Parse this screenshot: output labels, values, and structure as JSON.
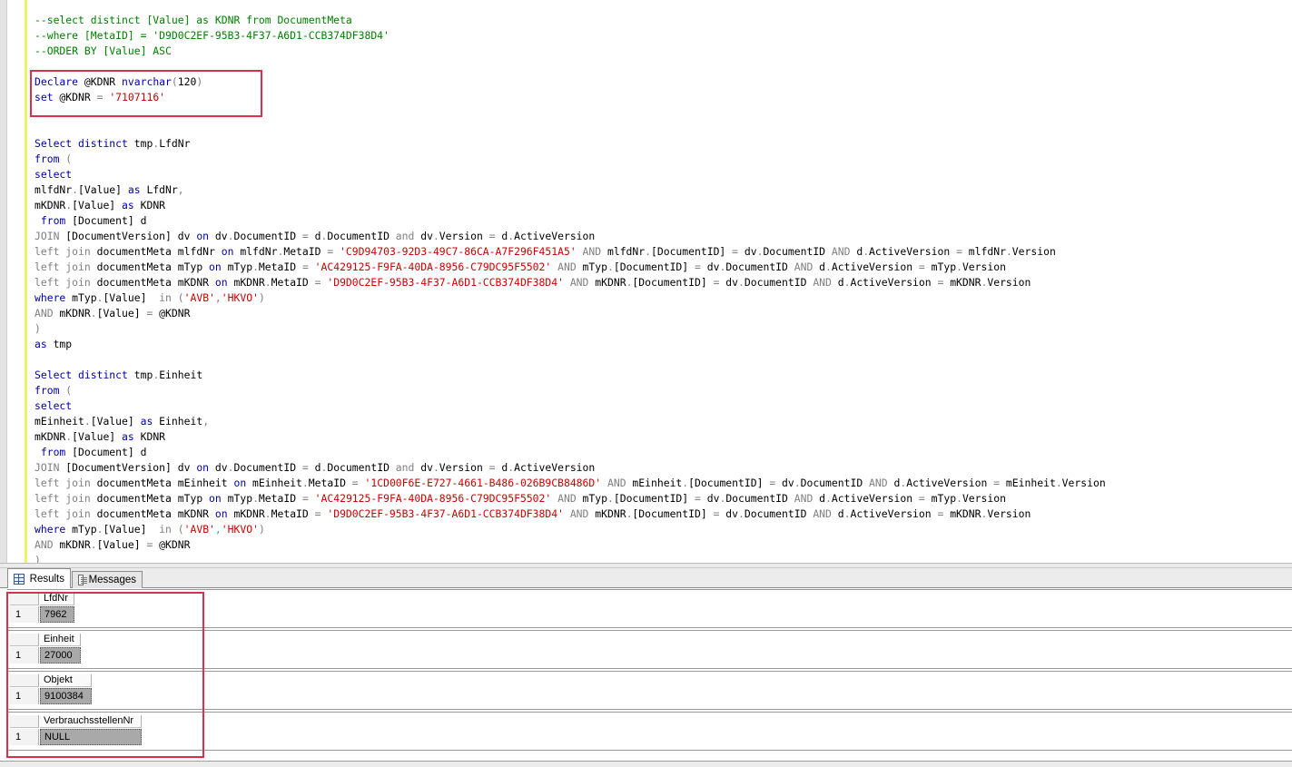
{
  "editor": {
    "lines": [
      [
        {
          "t": "--select distinct [Value] as KDNR from DocumentMeta",
          "c": "cmt"
        }
      ],
      [
        {
          "t": "--where [MetaID] = 'D9D0C2EF-95B3-4F37-A6D1-CCB374DF38D4'",
          "c": "cmt"
        }
      ],
      [
        {
          "t": "--ORDER BY [Value] ASC",
          "c": "cmt"
        }
      ],
      [],
      [
        {
          "t": "Declare",
          "c": "kw2"
        },
        {
          "t": " @KDNR "
        },
        {
          "t": "nvarchar",
          "c": "kw2"
        },
        {
          "t": "(",
          "c": "gray"
        },
        {
          "t": "120"
        },
        {
          "t": ")",
          "c": "gray"
        }
      ],
      [
        {
          "t": "set",
          "c": "kw2"
        },
        {
          "t": " @KDNR "
        },
        {
          "t": "=",
          "c": "gray"
        },
        {
          "t": " "
        },
        {
          "t": "'7107116'",
          "c": "str"
        }
      ],
      [],
      [],
      [
        {
          "t": "Select",
          "c": "kw2"
        },
        {
          "t": " "
        },
        {
          "t": "distinct",
          "c": "kw2"
        },
        {
          "t": " tmp"
        },
        {
          "t": ".",
          "c": "gray"
        },
        {
          "t": "LfdNr"
        }
      ],
      [
        {
          "t": "from",
          "c": "kw2"
        },
        {
          "t": " "
        },
        {
          "t": "(",
          "c": "gray"
        }
      ],
      [
        {
          "t": "select",
          "c": "kw2"
        }
      ],
      [
        {
          "t": "mlfdNr"
        },
        {
          "t": ".",
          "c": "gray"
        },
        {
          "t": "[Value] "
        },
        {
          "t": "as",
          "c": "kw2"
        },
        {
          "t": " LfdNr"
        },
        {
          "t": ",",
          "c": "gray"
        }
      ],
      [
        {
          "t": "mKDNR"
        },
        {
          "t": ".",
          "c": "gray"
        },
        {
          "t": "[Value] "
        },
        {
          "t": "as",
          "c": "kw2"
        },
        {
          "t": " KDNR"
        }
      ],
      [
        {
          "t": " "
        },
        {
          "t": "from",
          "c": "kw2"
        },
        {
          "t": " [Document] d"
        }
      ],
      [
        {
          "t": "JOIN",
          "c": "gray"
        },
        {
          "t": " [DocumentVersion] dv "
        },
        {
          "t": "on",
          "c": "kw2"
        },
        {
          "t": " dv"
        },
        {
          "t": ".",
          "c": "gray"
        },
        {
          "t": "DocumentID "
        },
        {
          "t": "=",
          "c": "gray"
        },
        {
          "t": " d"
        },
        {
          "t": ".",
          "c": "gray"
        },
        {
          "t": "DocumentID "
        },
        {
          "t": "and",
          "c": "gray"
        },
        {
          "t": " dv"
        },
        {
          "t": ".",
          "c": "gray"
        },
        {
          "t": "Version "
        },
        {
          "t": "=",
          "c": "gray"
        },
        {
          "t": " d"
        },
        {
          "t": ".",
          "c": "gray"
        },
        {
          "t": "ActiveVersion"
        }
      ],
      [
        {
          "t": "left join",
          "c": "gray"
        },
        {
          "t": " documentMeta mlfdNr "
        },
        {
          "t": "on",
          "c": "kw2"
        },
        {
          "t": " mlfdNr"
        },
        {
          "t": ".",
          "c": "gray"
        },
        {
          "t": "MetaID "
        },
        {
          "t": "=",
          "c": "gray"
        },
        {
          "t": " "
        },
        {
          "t": "'C9D94703-92D3-49C7-86CA-A7F296F451A5'",
          "c": "str"
        },
        {
          "t": " "
        },
        {
          "t": "AND",
          "c": "gray"
        },
        {
          "t": " mlfdNr"
        },
        {
          "t": ".",
          "c": "gray"
        },
        {
          "t": "[DocumentID] "
        },
        {
          "t": "=",
          "c": "gray"
        },
        {
          "t": " dv"
        },
        {
          "t": ".",
          "c": "gray"
        },
        {
          "t": "DocumentID "
        },
        {
          "t": "AND",
          "c": "gray"
        },
        {
          "t": " d"
        },
        {
          "t": ".",
          "c": "gray"
        },
        {
          "t": "ActiveVersion "
        },
        {
          "t": "=",
          "c": "gray"
        },
        {
          "t": " mlfdNr"
        },
        {
          "t": ".",
          "c": "gray"
        },
        {
          "t": "Version"
        }
      ],
      [
        {
          "t": "left join",
          "c": "gray"
        },
        {
          "t": " documentMeta mTyp "
        },
        {
          "t": "on",
          "c": "kw2"
        },
        {
          "t": " mTyp"
        },
        {
          "t": ".",
          "c": "gray"
        },
        {
          "t": "MetaID "
        },
        {
          "t": "=",
          "c": "gray"
        },
        {
          "t": " "
        },
        {
          "t": "'AC429125-F9FA-40DA-8956-C79DC95F5502'",
          "c": "str"
        },
        {
          "t": " "
        },
        {
          "t": "AND",
          "c": "gray"
        },
        {
          "t": " mTyp"
        },
        {
          "t": ".",
          "c": "gray"
        },
        {
          "t": "[DocumentID] "
        },
        {
          "t": "=",
          "c": "gray"
        },
        {
          "t": " dv"
        },
        {
          "t": ".",
          "c": "gray"
        },
        {
          "t": "DocumentID "
        },
        {
          "t": "AND",
          "c": "gray"
        },
        {
          "t": " d"
        },
        {
          "t": ".",
          "c": "gray"
        },
        {
          "t": "ActiveVersion "
        },
        {
          "t": "=",
          "c": "gray"
        },
        {
          "t": " mTyp"
        },
        {
          "t": ".",
          "c": "gray"
        },
        {
          "t": "Version"
        }
      ],
      [
        {
          "t": "left join",
          "c": "gray"
        },
        {
          "t": " documentMeta mKDNR "
        },
        {
          "t": "on",
          "c": "kw2"
        },
        {
          "t": " mKDNR"
        },
        {
          "t": ".",
          "c": "gray"
        },
        {
          "t": "MetaID "
        },
        {
          "t": "=",
          "c": "gray"
        },
        {
          "t": " "
        },
        {
          "t": "'D9D0C2EF-95B3-4F37-A6D1-CCB374DF38D4'",
          "c": "str"
        },
        {
          "t": " "
        },
        {
          "t": "AND",
          "c": "gray"
        },
        {
          "t": " mKDNR"
        },
        {
          "t": ".",
          "c": "gray"
        },
        {
          "t": "[DocumentID] "
        },
        {
          "t": "=",
          "c": "gray"
        },
        {
          "t": " dv"
        },
        {
          "t": ".",
          "c": "gray"
        },
        {
          "t": "DocumentID "
        },
        {
          "t": "AND",
          "c": "gray"
        },
        {
          "t": " d"
        },
        {
          "t": ".",
          "c": "gray"
        },
        {
          "t": "ActiveVersion "
        },
        {
          "t": "=",
          "c": "gray"
        },
        {
          "t": " mKDNR"
        },
        {
          "t": ".",
          "c": "gray"
        },
        {
          "t": "Version"
        }
      ],
      [
        {
          "t": "where",
          "c": "kw2"
        },
        {
          "t": " mTyp"
        },
        {
          "t": ".",
          "c": "gray"
        },
        {
          "t": "[Value]  "
        },
        {
          "t": "in",
          "c": "gray"
        },
        {
          "t": " "
        },
        {
          "t": "(",
          "c": "gray"
        },
        {
          "t": "'AVB'",
          "c": "str"
        },
        {
          "t": ",",
          "c": "gray"
        },
        {
          "t": "'HKVO'",
          "c": "str"
        },
        {
          "t": ")",
          "c": "gray"
        }
      ],
      [
        {
          "t": "AND",
          "c": "gray"
        },
        {
          "t": " mKDNR"
        },
        {
          "t": ".",
          "c": "gray"
        },
        {
          "t": "[Value] "
        },
        {
          "t": "=",
          "c": "gray"
        },
        {
          "t": " @KDNR"
        }
      ],
      [
        {
          "t": ")",
          "c": "gray"
        }
      ],
      [
        {
          "t": "as",
          "c": "kw2"
        },
        {
          "t": " tmp"
        }
      ],
      [],
      [
        {
          "t": "Select",
          "c": "kw2"
        },
        {
          "t": " "
        },
        {
          "t": "distinct",
          "c": "kw2"
        },
        {
          "t": " tmp"
        },
        {
          "t": ".",
          "c": "gray"
        },
        {
          "t": "Einheit"
        }
      ],
      [
        {
          "t": "from",
          "c": "kw2"
        },
        {
          "t": " "
        },
        {
          "t": "(",
          "c": "gray"
        }
      ],
      [
        {
          "t": "select",
          "c": "kw2"
        }
      ],
      [
        {
          "t": "mEinheit"
        },
        {
          "t": ".",
          "c": "gray"
        },
        {
          "t": "[Value] "
        },
        {
          "t": "as",
          "c": "kw2"
        },
        {
          "t": " Einheit"
        },
        {
          "t": ",",
          "c": "gray"
        }
      ],
      [
        {
          "t": "mKDNR"
        },
        {
          "t": ".",
          "c": "gray"
        },
        {
          "t": "[Value] "
        },
        {
          "t": "as",
          "c": "kw2"
        },
        {
          "t": " KDNR"
        }
      ],
      [
        {
          "t": " "
        },
        {
          "t": "from",
          "c": "kw2"
        },
        {
          "t": " [Document] d"
        }
      ],
      [
        {
          "t": "JOIN",
          "c": "gray"
        },
        {
          "t": " [DocumentVersion] dv "
        },
        {
          "t": "on",
          "c": "kw2"
        },
        {
          "t": " dv"
        },
        {
          "t": ".",
          "c": "gray"
        },
        {
          "t": "DocumentID "
        },
        {
          "t": "=",
          "c": "gray"
        },
        {
          "t": " d"
        },
        {
          "t": ".",
          "c": "gray"
        },
        {
          "t": "DocumentID "
        },
        {
          "t": "and",
          "c": "gray"
        },
        {
          "t": " dv"
        },
        {
          "t": ".",
          "c": "gray"
        },
        {
          "t": "Version "
        },
        {
          "t": "=",
          "c": "gray"
        },
        {
          "t": " d"
        },
        {
          "t": ".",
          "c": "gray"
        },
        {
          "t": "ActiveVersion"
        }
      ],
      [
        {
          "t": "left join",
          "c": "gray"
        },
        {
          "t": " documentMeta mEinheit "
        },
        {
          "t": "on",
          "c": "kw2"
        },
        {
          "t": " mEinheit"
        },
        {
          "t": ".",
          "c": "gray"
        },
        {
          "t": "MetaID "
        },
        {
          "t": "=",
          "c": "gray"
        },
        {
          "t": " "
        },
        {
          "t": "'1CD00F6E-E727-4661-B486-026B9CB8486D'",
          "c": "str"
        },
        {
          "t": " "
        },
        {
          "t": "AND",
          "c": "gray"
        },
        {
          "t": " mEinheit"
        },
        {
          "t": ".",
          "c": "gray"
        },
        {
          "t": "[DocumentID] "
        },
        {
          "t": "=",
          "c": "gray"
        },
        {
          "t": " dv"
        },
        {
          "t": ".",
          "c": "gray"
        },
        {
          "t": "DocumentID "
        },
        {
          "t": "AND",
          "c": "gray"
        },
        {
          "t": " d"
        },
        {
          "t": ".",
          "c": "gray"
        },
        {
          "t": "ActiveVersion "
        },
        {
          "t": "=",
          "c": "gray"
        },
        {
          "t": " mEinheit"
        },
        {
          "t": ".",
          "c": "gray"
        },
        {
          "t": "Version"
        }
      ],
      [
        {
          "t": "left join",
          "c": "gray"
        },
        {
          "t": " documentMeta mTyp "
        },
        {
          "t": "on",
          "c": "kw2"
        },
        {
          "t": " mTyp"
        },
        {
          "t": ".",
          "c": "gray"
        },
        {
          "t": "MetaID "
        },
        {
          "t": "=",
          "c": "gray"
        },
        {
          "t": " "
        },
        {
          "t": "'AC429125-F9FA-40DA-8956-C79DC95F5502'",
          "c": "str"
        },
        {
          "t": " "
        },
        {
          "t": "AND",
          "c": "gray"
        },
        {
          "t": " mTyp"
        },
        {
          "t": ".",
          "c": "gray"
        },
        {
          "t": "[DocumentID] "
        },
        {
          "t": "=",
          "c": "gray"
        },
        {
          "t": " dv"
        },
        {
          "t": ".",
          "c": "gray"
        },
        {
          "t": "DocumentID "
        },
        {
          "t": "AND",
          "c": "gray"
        },
        {
          "t": " d"
        },
        {
          "t": ".",
          "c": "gray"
        },
        {
          "t": "ActiveVersion "
        },
        {
          "t": "=",
          "c": "gray"
        },
        {
          "t": " mTyp"
        },
        {
          "t": ".",
          "c": "gray"
        },
        {
          "t": "Version"
        }
      ],
      [
        {
          "t": "left join",
          "c": "gray"
        },
        {
          "t": " documentMeta mKDNR "
        },
        {
          "t": "on",
          "c": "kw2"
        },
        {
          "t": " mKDNR"
        },
        {
          "t": ".",
          "c": "gray"
        },
        {
          "t": "MetaID "
        },
        {
          "t": "=",
          "c": "gray"
        },
        {
          "t": " "
        },
        {
          "t": "'D9D0C2EF-95B3-4F37-A6D1-CCB374DF38D4'",
          "c": "str"
        },
        {
          "t": " "
        },
        {
          "t": "AND",
          "c": "gray"
        },
        {
          "t": " mKDNR"
        },
        {
          "t": ".",
          "c": "gray"
        },
        {
          "t": "[DocumentID] "
        },
        {
          "t": "=",
          "c": "gray"
        },
        {
          "t": " dv"
        },
        {
          "t": ".",
          "c": "gray"
        },
        {
          "t": "DocumentID "
        },
        {
          "t": "AND",
          "c": "gray"
        },
        {
          "t": " d"
        },
        {
          "t": ".",
          "c": "gray"
        },
        {
          "t": "ActiveVersion "
        },
        {
          "t": "=",
          "c": "gray"
        },
        {
          "t": " mKDNR"
        },
        {
          "t": ".",
          "c": "gray"
        },
        {
          "t": "Version"
        }
      ],
      [
        {
          "t": "where",
          "c": "kw2"
        },
        {
          "t": " mTyp"
        },
        {
          "t": ".",
          "c": "gray"
        },
        {
          "t": "[Value]  "
        },
        {
          "t": "in",
          "c": "gray"
        },
        {
          "t": " "
        },
        {
          "t": "(",
          "c": "gray"
        },
        {
          "t": "'AVB'",
          "c": "str"
        },
        {
          "t": ",",
          "c": "gray"
        },
        {
          "t": "'HKVO'",
          "c": "str"
        },
        {
          "t": ")",
          "c": "gray"
        }
      ],
      [
        {
          "t": "AND",
          "c": "gray"
        },
        {
          "t": " mKDNR"
        },
        {
          "t": ".",
          "c": "gray"
        },
        {
          "t": "[Value] "
        },
        {
          "t": "=",
          "c": "gray"
        },
        {
          "t": " @KDNR"
        }
      ],
      [
        {
          "t": ")",
          "c": "gray"
        }
      ]
    ]
  },
  "tabs": {
    "results_label": "Results",
    "messages_label": "Messages"
  },
  "results": {
    "grids": [
      {
        "column": "LfdNr",
        "row_number": "1",
        "value": "7962"
      },
      {
        "column": "Einheit",
        "row_number": "1",
        "value": "27000"
      },
      {
        "column": "Objekt",
        "row_number": "1",
        "value": "9100384"
      },
      {
        "column": "VerbrauchsstellenNr",
        "row_number": "1",
        "value": "NULL"
      }
    ]
  },
  "colors": {
    "highlight_box": "#d9304f",
    "keyword": "#0000aa",
    "operator": "#808080",
    "string": "#cc0000",
    "comment": "#008000",
    "selected_cell": "#a9a9a9"
  }
}
